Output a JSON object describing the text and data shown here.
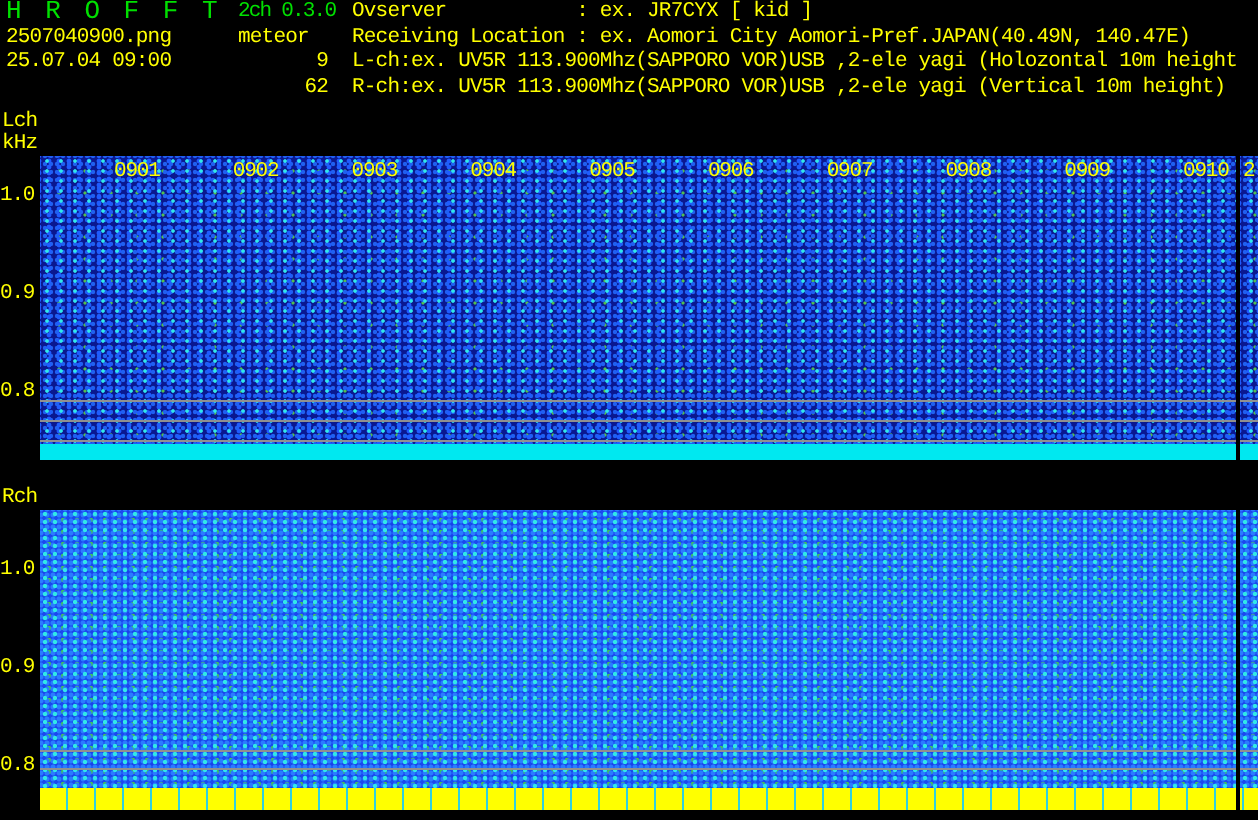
{
  "app": {
    "title": "H R O F F T",
    "version": "2ch 0.3.0"
  },
  "file": {
    "name": "2507040900.png",
    "timestamp": "25.07.04 09:00"
  },
  "meteor": {
    "label": "meteor",
    "counts": [
      "9",
      "62"
    ]
  },
  "info_lines": [
    "Ovserver           : ex. JR7CYX [ kid ]",
    "Receiving Location : ex. Aomori City Aomori-Pref.JAPAN(40.49N, 140.47E)",
    "L-ch:ex. UV5R 113.900Mhz(SAPPORO VOR)USB ,2-ele yagi (Holozontal 10m height",
    "R-ch:ex. UV5R 113.900Mhz(SAPPORO VOR)USB ,2-ele yagi (Vertical 10m height)"
  ],
  "channels": [
    {
      "label": "Lch",
      "unit": "kHz",
      "time_labels": [
        "0901",
        "0902",
        "0903",
        "0904",
        "0905",
        "0906",
        "0907",
        "0908",
        "0909",
        "0910",
        "2"
      ],
      "yticks": [
        "1.0",
        "0.9",
        "0.8"
      ]
    },
    {
      "label": "Rch",
      "yticks": [
        "1.0",
        "0.9",
        "0.8"
      ]
    }
  ]
}
